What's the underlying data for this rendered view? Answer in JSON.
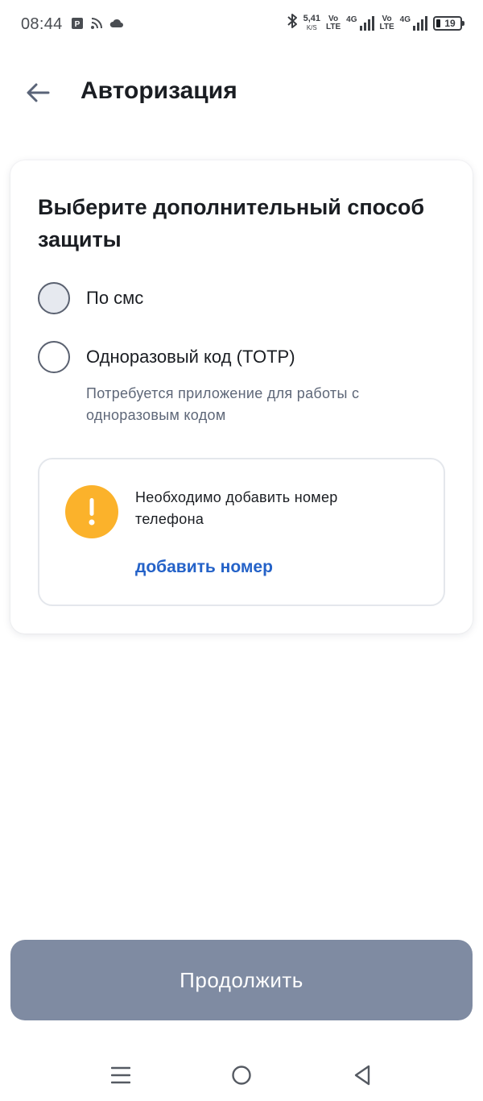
{
  "status_bar": {
    "time": "08:44",
    "net_speed_value": "5,41",
    "net_speed_unit": "K/S",
    "volte_top": "Vo",
    "volte_bottom": "LTE",
    "sim1_tag": "4G",
    "sim2_tag": "4G",
    "battery_level": "19",
    "icons": [
      "notification-app-icon",
      "rss-icon",
      "cloud-icon",
      "bluetooth-icon",
      "signal-icon",
      "battery-icon"
    ]
  },
  "header": {
    "title": "Авторизация",
    "back_icon": "arrow-left-icon"
  },
  "card": {
    "title": "Выберите дополнительный способ защиты",
    "options": [
      {
        "label": "По смс",
        "selected": false
      },
      {
        "label": "Одноразовый код (TOTP)",
        "selected": false
      }
    ],
    "totp_hint": "Потребуется приложение для работы с одноразовым кодом",
    "notice": {
      "icon": "warning-icon",
      "text": "Необходимо добавить номер телефона",
      "link": "добавить номер"
    }
  },
  "footer": {
    "continue_label": "Продолжить"
  },
  "colors": {
    "accent_link": "#2462c8",
    "warning": "#fbb22b",
    "button_disabled": "#7f8ba2",
    "text_primary": "#1a1d22",
    "text_secondary": "#5e6778"
  }
}
